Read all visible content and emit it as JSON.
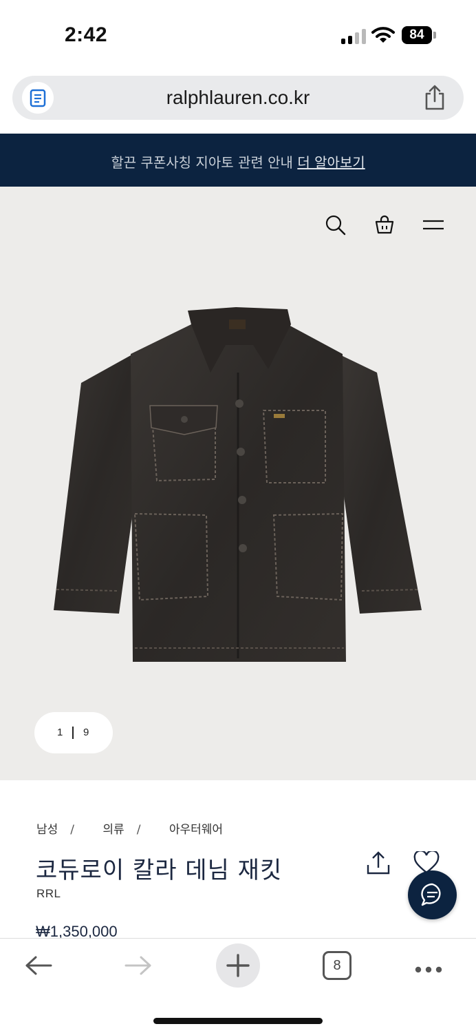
{
  "status_bar": {
    "time": "2:42",
    "battery": "84",
    "icons": [
      "signal-icon",
      "wifi-icon",
      "battery-icon"
    ]
  },
  "address_bar": {
    "url": "ralphlauren.co.kr",
    "icons": [
      "reader-icon",
      "share-icon"
    ]
  },
  "banner": {
    "text": "할끈 쿠폰사칭 지아토 관련 안내",
    "link_label": "더 알아보기",
    "background": "#0c2340"
  },
  "header_icons": [
    "search-icon",
    "shopping-bag-icon",
    "menu-icon"
  ],
  "gallery": {
    "current": "1",
    "total": "9"
  },
  "breadcrumb": [
    "남성",
    "의류",
    "아우터웨어"
  ],
  "product": {
    "title": "코듀로이 칼라 데님 재킷",
    "brand": "RRL",
    "price": "₩1,350,000",
    "accent": "#1b2740"
  },
  "bottom_toolbar": {
    "tab_count": "8",
    "icons": [
      "back-arrow-icon",
      "forward-arrow-icon",
      "plus-icon",
      "tabs-icon",
      "more-icon"
    ]
  }
}
